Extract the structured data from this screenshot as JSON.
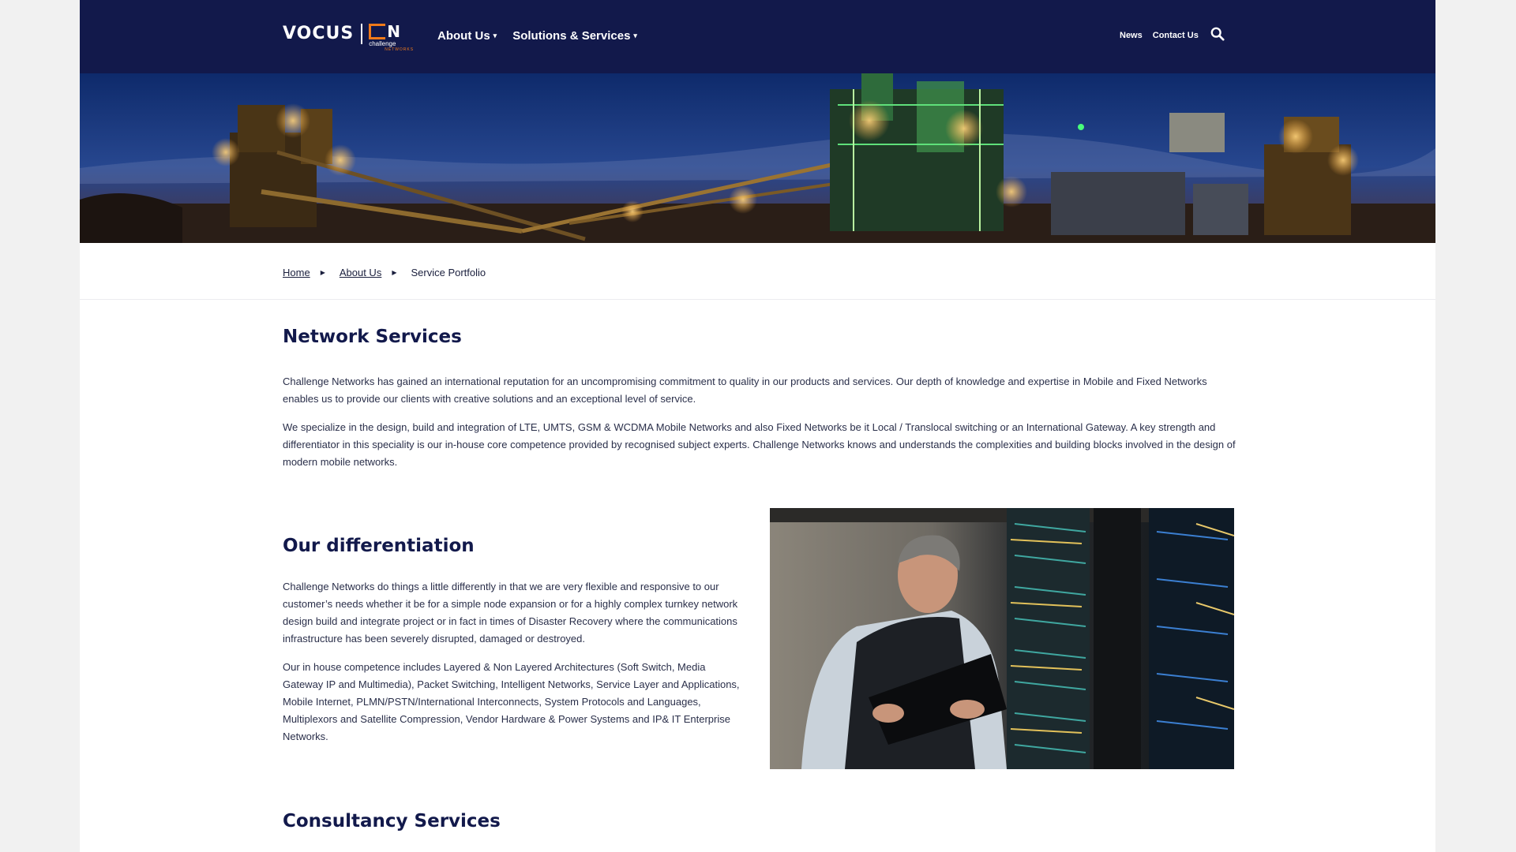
{
  "header": {
    "logo": {
      "brand": "VOCUS",
      "sub_mark": "N",
      "sub_name": "challenge",
      "sub_tag": "NETWORKS"
    },
    "nav": [
      {
        "label": "About Us",
        "has_dropdown": true
      },
      {
        "label": "Solutions & Services",
        "has_dropdown": true
      }
    ],
    "utility": [
      {
        "label": "News"
      },
      {
        "label": "Contact Us"
      }
    ],
    "search_icon": "search-icon"
  },
  "breadcrumb": [
    {
      "label": "Home",
      "link": true
    },
    {
      "label": "About Us",
      "link": true
    },
    {
      "label": "Service Portfolio",
      "link": false
    }
  ],
  "sections": {
    "network": {
      "title": "Network Services",
      "paragraphs": [
        "Challenge Networks has gained an international reputation for an uncompromising commitment to quality in our products and services. Our depth of knowledge and expertise in Mobile and Fixed Networks enables us to provide our clients with creative solutions and an exceptional level of service.",
        "We specialize in the design, build and integration of LTE, UMTS, GSM & WCDMA Mobile Networks and also Fixed Networks be it Local / Translocal switching or an International Gateway. A key strength and differentiator in this speciality is our in-house core competence provided by recognised subject experts. Challenge Networks knows and understands the complexities and building blocks involved in the design of modern mobile networks."
      ]
    },
    "differentiation": {
      "title": "Our differentiation",
      "paragraphs": [
        "Challenge Networks do things a little differently in that we are very flexible and responsive to our customer’s needs whether it be for a simple node expansion or for a highly complex turnkey network design build and integrate project or in fact in times of Disaster Recovery where the communications infrastructure has been severely disrupted, damaged or destroyed.",
        "Our in house competence includes Layered & Non Layered Architectures (Soft Switch, Media Gateway IP and Multimedia), Packet Switching, Intelligent Networks, Service Layer and Applications, Mobile Internet, PLMN/PSTN/International Interconnects, System Protocols and Languages, Multiplexors and Satellite Compression, Vendor Hardware & Power Systems and IP& IT Enterprise Networks."
      ]
    },
    "consultancy": {
      "title": "Consultancy Services"
    }
  },
  "colors": {
    "navy": "#12194b",
    "orange": "#f07a1a",
    "text": "#2a2f4a"
  }
}
